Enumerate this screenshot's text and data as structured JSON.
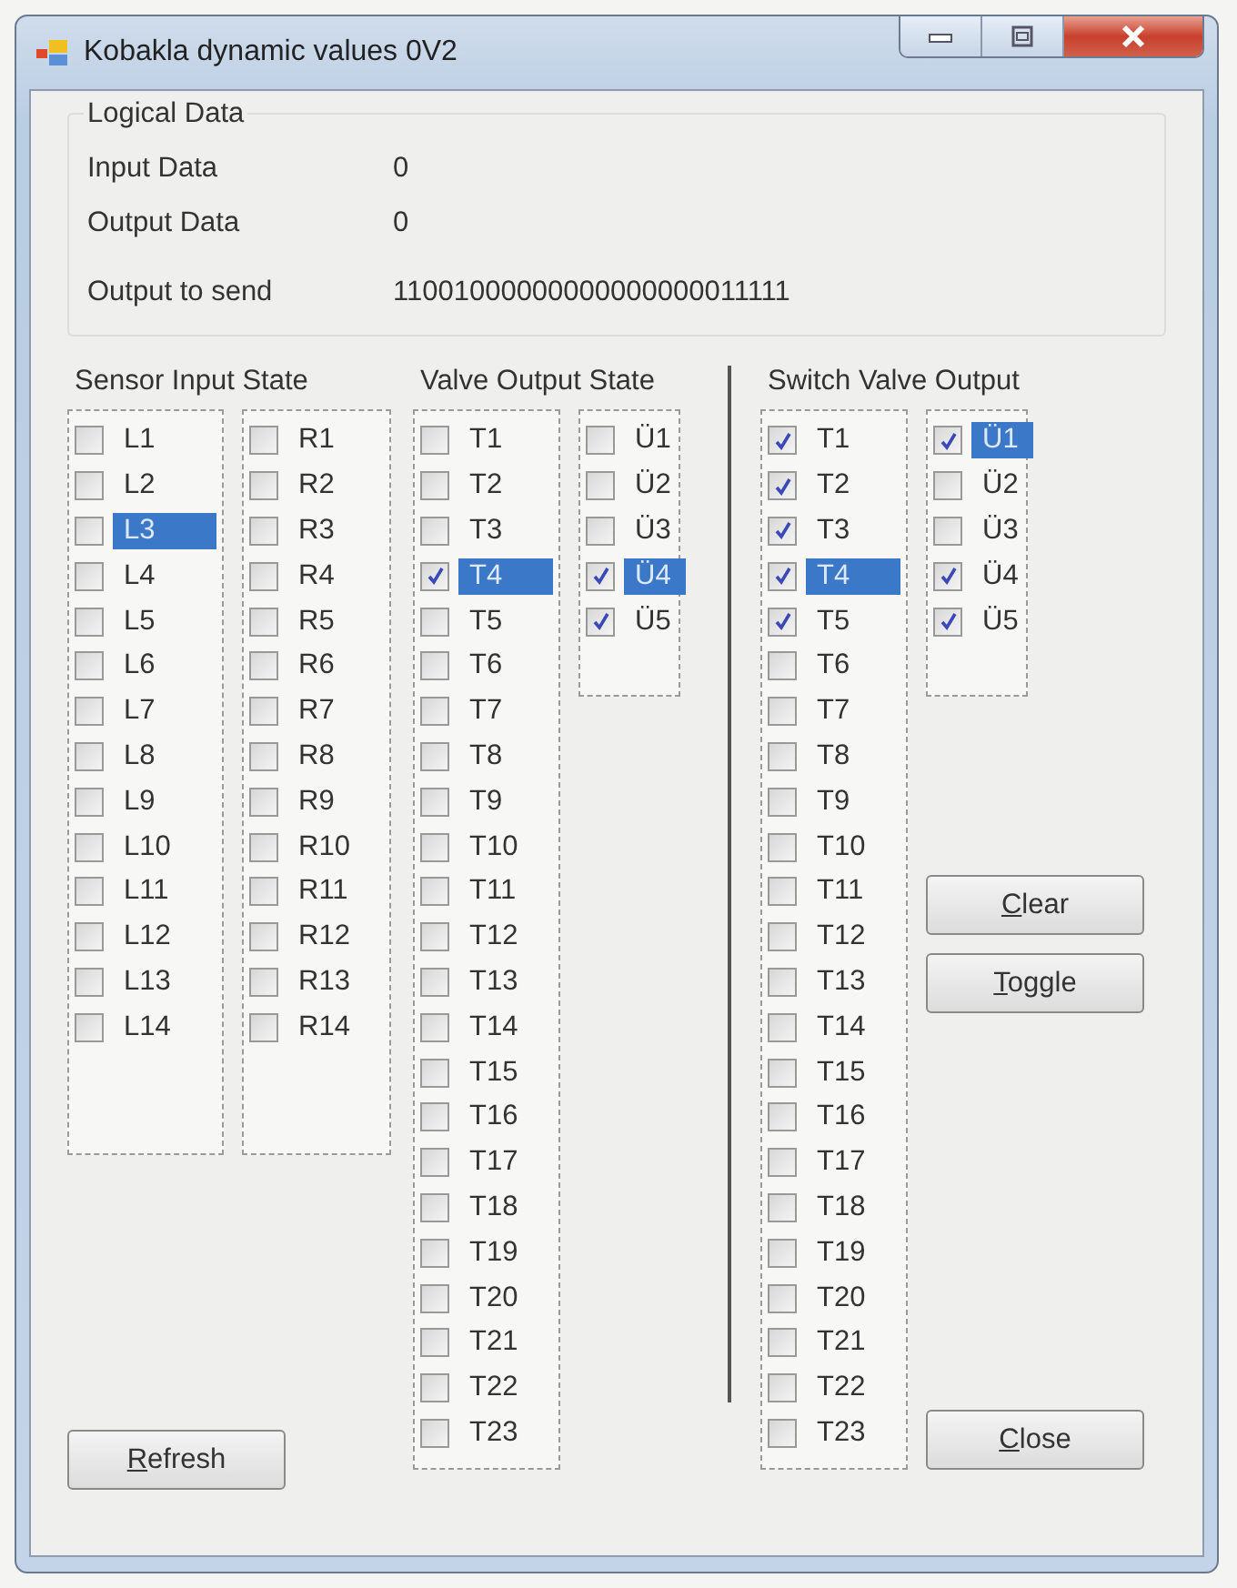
{
  "window": {
    "title": "Kobakla dynamic values 0V2"
  },
  "logical_data": {
    "title": "Logical Data",
    "rows": [
      {
        "label": "Input Data",
        "value": "0"
      },
      {
        "label": "Output Data",
        "value": "0"
      },
      {
        "label": "Output to send",
        "value": "11001000000000000000011111"
      }
    ]
  },
  "sensor_input_state": {
    "title": "Sensor Input State",
    "lists": [
      {
        "items": [
          {
            "label": "L1",
            "checked": false,
            "selected": false
          },
          {
            "label": "L2",
            "checked": false,
            "selected": false
          },
          {
            "label": "L3",
            "checked": false,
            "selected": true
          },
          {
            "label": "L4",
            "checked": false,
            "selected": false
          },
          {
            "label": "L5",
            "checked": false,
            "selected": false
          },
          {
            "label": "L6",
            "checked": false,
            "selected": false
          },
          {
            "label": "L7",
            "checked": false,
            "selected": false
          },
          {
            "label": "L8",
            "checked": false,
            "selected": false
          },
          {
            "label": "L9",
            "checked": false,
            "selected": false
          },
          {
            "label": "L10",
            "checked": false,
            "selected": false
          },
          {
            "label": "L11",
            "checked": false,
            "selected": false
          },
          {
            "label": "L12",
            "checked": false,
            "selected": false
          },
          {
            "label": "L13",
            "checked": false,
            "selected": false
          },
          {
            "label": "L14",
            "checked": false,
            "selected": false
          }
        ]
      },
      {
        "items": [
          {
            "label": "R1",
            "checked": false,
            "selected": false
          },
          {
            "label": "R2",
            "checked": false,
            "selected": false
          },
          {
            "label": "R3",
            "checked": false,
            "selected": false
          },
          {
            "label": "R4",
            "checked": false,
            "selected": false
          },
          {
            "label": "R5",
            "checked": false,
            "selected": false
          },
          {
            "label": "R6",
            "checked": false,
            "selected": false
          },
          {
            "label": "R7",
            "checked": false,
            "selected": false
          },
          {
            "label": "R8",
            "checked": false,
            "selected": false
          },
          {
            "label": "R9",
            "checked": false,
            "selected": false
          },
          {
            "label": "R10",
            "checked": false,
            "selected": false
          },
          {
            "label": "R11",
            "checked": false,
            "selected": false
          },
          {
            "label": "R12",
            "checked": false,
            "selected": false
          },
          {
            "label": "R13",
            "checked": false,
            "selected": false
          },
          {
            "label": "R14",
            "checked": false,
            "selected": false
          }
        ]
      }
    ]
  },
  "valve_output_state": {
    "title": "Valve Output State",
    "lists": [
      {
        "items": [
          {
            "label": "T1",
            "checked": false,
            "selected": false
          },
          {
            "label": "T2",
            "checked": false,
            "selected": false
          },
          {
            "label": "T3",
            "checked": false,
            "selected": false
          },
          {
            "label": "T4",
            "checked": true,
            "selected": true
          },
          {
            "label": "T5",
            "checked": false,
            "selected": false
          },
          {
            "label": "T6",
            "checked": false,
            "selected": false
          },
          {
            "label": "T7",
            "checked": false,
            "selected": false
          },
          {
            "label": "T8",
            "checked": false,
            "selected": false
          },
          {
            "label": "T9",
            "checked": false,
            "selected": false
          },
          {
            "label": "T10",
            "checked": false,
            "selected": false
          },
          {
            "label": "T11",
            "checked": false,
            "selected": false
          },
          {
            "label": "T12",
            "checked": false,
            "selected": false
          },
          {
            "label": "T13",
            "checked": false,
            "selected": false
          },
          {
            "label": "T14",
            "checked": false,
            "selected": false
          },
          {
            "label": "T15",
            "checked": false,
            "selected": false
          },
          {
            "label": "T16",
            "checked": false,
            "selected": false
          },
          {
            "label": "T17",
            "checked": false,
            "selected": false
          },
          {
            "label": "T18",
            "checked": false,
            "selected": false
          },
          {
            "label": "T19",
            "checked": false,
            "selected": false
          },
          {
            "label": "T20",
            "checked": false,
            "selected": false
          },
          {
            "label": "T21",
            "checked": false,
            "selected": false
          },
          {
            "label": "T22",
            "checked": false,
            "selected": false
          },
          {
            "label": "T23",
            "checked": false,
            "selected": false
          }
        ]
      },
      {
        "items": [
          {
            "label": "Ü1",
            "checked": false,
            "selected": false
          },
          {
            "label": "Ü2",
            "checked": false,
            "selected": false
          },
          {
            "label": "Ü3",
            "checked": false,
            "selected": false
          },
          {
            "label": "Ü4",
            "checked": true,
            "selected": true
          },
          {
            "label": "Ü5",
            "checked": true,
            "selected": false
          }
        ]
      }
    ]
  },
  "switch_valve_output": {
    "title": "Switch Valve Output",
    "lists": [
      {
        "items": [
          {
            "label": "T1",
            "checked": true,
            "selected": false
          },
          {
            "label": "T2",
            "checked": true,
            "selected": false
          },
          {
            "label": "T3",
            "checked": true,
            "selected": false
          },
          {
            "label": "T4",
            "checked": true,
            "selected": true
          },
          {
            "label": "T5",
            "checked": true,
            "selected": false
          },
          {
            "label": "T6",
            "checked": false,
            "selected": false
          },
          {
            "label": "T7",
            "checked": false,
            "selected": false
          },
          {
            "label": "T8",
            "checked": false,
            "selected": false
          },
          {
            "label": "T9",
            "checked": false,
            "selected": false
          },
          {
            "label": "T10",
            "checked": false,
            "selected": false
          },
          {
            "label": "T11",
            "checked": false,
            "selected": false
          },
          {
            "label": "T12",
            "checked": false,
            "selected": false
          },
          {
            "label": "T13",
            "checked": false,
            "selected": false
          },
          {
            "label": "T14",
            "checked": false,
            "selected": false
          },
          {
            "label": "T15",
            "checked": false,
            "selected": false
          },
          {
            "label": "T16",
            "checked": false,
            "selected": false
          },
          {
            "label": "T17",
            "checked": false,
            "selected": false
          },
          {
            "label": "T18",
            "checked": false,
            "selected": false
          },
          {
            "label": "T19",
            "checked": false,
            "selected": false
          },
          {
            "label": "T20",
            "checked": false,
            "selected": false
          },
          {
            "label": "T21",
            "checked": false,
            "selected": false
          },
          {
            "label": "T22",
            "checked": false,
            "selected": false
          },
          {
            "label": "T23",
            "checked": false,
            "selected": false
          }
        ]
      },
      {
        "items": [
          {
            "label": "Ü1",
            "checked": true,
            "selected": true
          },
          {
            "label": "Ü2",
            "checked": false,
            "selected": false
          },
          {
            "label": "Ü3",
            "checked": false,
            "selected": false
          },
          {
            "label": "Ü4",
            "checked": true,
            "selected": false
          },
          {
            "label": "Ü5",
            "checked": true,
            "selected": false
          }
        ]
      }
    ]
  },
  "buttons": [
    {
      "kind": "clear",
      "label": "Clear"
    },
    {
      "kind": "toggle",
      "label": "Toggle"
    },
    {
      "kind": "refresh",
      "label": "Refresh"
    },
    {
      "kind": "close",
      "label": "Close"
    }
  ]
}
